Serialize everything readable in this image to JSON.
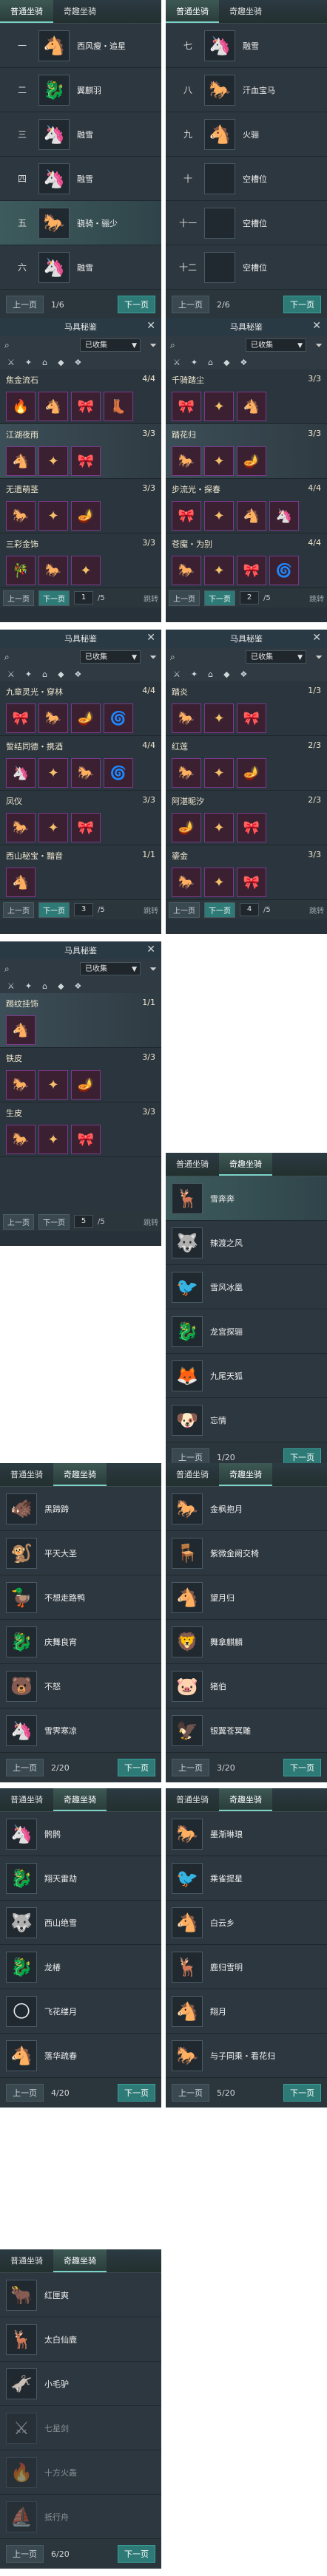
{
  "tabs": {
    "normal": "普通坐骑",
    "rare": "奇趣坐骑"
  },
  "pager": {
    "prev": "上一页",
    "next": "下一页"
  },
  "panel1": {
    "page": "1/6",
    "rows": [
      {
        "num": "一",
        "name": "西风瘦・追星",
        "icon": "🐴"
      },
      {
        "num": "二",
        "name": "翼麒羽",
        "icon": "🐉"
      },
      {
        "num": "三",
        "name": "融雪",
        "icon": "🦄"
      },
      {
        "num": "四",
        "name": "融雪",
        "icon": "🦄"
      },
      {
        "num": "五",
        "name": "骁骑・骊少",
        "icon": "🐎"
      },
      {
        "num": "六",
        "name": "融雪",
        "icon": "🦄"
      }
    ]
  },
  "panel2": {
    "page": "2/6",
    "rows": [
      {
        "num": "七",
        "name": "融雪",
        "icon": "🦄"
      },
      {
        "num": "八",
        "name": "汗血宝马",
        "icon": "🐎"
      },
      {
        "num": "九",
        "name": "火骊",
        "icon": "🐴"
      },
      {
        "num": "十",
        "name": "空槽位",
        "icon": ""
      },
      {
        "num": "十一",
        "name": "空槽位",
        "icon": ""
      },
      {
        "num": "十二",
        "name": "空槽位",
        "icon": ""
      }
    ]
  },
  "acc": {
    "title": "马具秘鉴",
    "close": "✕",
    "collected": "已收集",
    "jump": "跳转",
    "prev": "上一页",
    "next": "下一页",
    "icon_strip": [
      "⚔",
      "✦",
      "⌂",
      "◆",
      "❖"
    ]
  },
  "acc1": {
    "page": "1",
    "total": "/5",
    "rows": [
      {
        "name": "焦金流石",
        "count": "4/4",
        "items": [
          "🔥",
          "🐴",
          "🎀",
          "👢"
        ]
      },
      {
        "name": "江湖夜雨",
        "count": "3/3",
        "items": [
          "🐴",
          "✦",
          "🎀"
        ]
      },
      {
        "name": "无遗萌茎",
        "count": "3/3",
        "items": [
          "🐎",
          "✦",
          "🪔"
        ]
      },
      {
        "name": "三彩金饰",
        "count": "3/3",
        "items": [
          "🎋",
          "🐎",
          "✦"
        ]
      }
    ]
  },
  "acc2": {
    "page": "2",
    "total": "/5",
    "rows": [
      {
        "name": "千骑踏尘",
        "count": "3/3",
        "items": [
          "🎀",
          "✦",
          "🐴"
        ]
      },
      {
        "name": "踏花归",
        "count": "3/3",
        "items": [
          "🐎",
          "✦",
          "🪔"
        ]
      },
      {
        "name": "步流光・探春",
        "count": "4/4",
        "items": [
          "🎀",
          "✦",
          "🐴",
          "🦄"
        ]
      },
      {
        "name": "苍魔・为别",
        "count": "4/4",
        "items": [
          "🐎",
          "✦",
          "🎀",
          "🌀"
        ]
      }
    ]
  },
  "acc3": {
    "page": "3",
    "total": "/5",
    "rows": [
      {
        "name": "九章灵光・穿林",
        "count": "4/4",
        "items": [
          "🎀",
          "🐎",
          "🪔",
          "🌀"
        ]
      },
      {
        "name": "誓结同德・携酒",
        "count": "4/4",
        "items": [
          "🦄",
          "✦",
          "🐎",
          "🌀"
        ]
      },
      {
        "name": "凤仪",
        "count": "3/3",
        "items": [
          "🐎",
          "✦",
          "🎀"
        ]
      },
      {
        "name": "西山秘宝・黯音",
        "count": "1/1",
        "items": [
          "🐴"
        ]
      }
    ]
  },
  "acc4": {
    "page": "4",
    "total": "/5",
    "rows": [
      {
        "name": "踏炎",
        "count": "1/3",
        "items": [
          "🐎",
          "✦",
          "🎀"
        ]
      },
      {
        "name": "红莲",
        "count": "2/3",
        "items": [
          "🐎",
          "✦",
          "🪔"
        ]
      },
      {
        "name": "阿湛昵汐",
        "count": "2/3",
        "items": [
          "🪔",
          "✦",
          "🎀"
        ]
      },
      {
        "name": "鎏金",
        "count": "3/3",
        "items": [
          "🐎",
          "✦",
          "🎀"
        ]
      }
    ]
  },
  "acc5": {
    "page": "5",
    "total": "/5",
    "rows": [
      {
        "name": "踢纹挂饰",
        "count": "1/1",
        "items": [
          "🐴"
        ]
      },
      {
        "name": "铁皮",
        "count": "3/3",
        "items": [
          "🐎",
          "✦",
          "🪔"
        ]
      },
      {
        "name": "生皮",
        "count": "3/3",
        "items": [
          "🐎",
          "✦",
          "🎀"
        ]
      }
    ]
  },
  "rare1": {
    "page": "1/20",
    "rows": [
      {
        "name": "雪奔奔",
        "icon": "🦌",
        "locked": false
      },
      {
        "name": "辣渡之风",
        "icon": "🐺",
        "locked": false
      },
      {
        "name": "雪风冰凰",
        "icon": "🐦",
        "locked": false
      },
      {
        "name": "龙宫探骊",
        "icon": "🐉",
        "locked": false
      },
      {
        "name": "九尾天狐",
        "icon": "🦊",
        "locked": false
      },
      {
        "name": "忘情",
        "icon": "🐶",
        "locked": false
      }
    ]
  },
  "rare2": {
    "page": "2/20",
    "rows": [
      {
        "name": "黑蹄蹄",
        "icon": "🐗",
        "locked": false
      },
      {
        "name": "平天大圣",
        "icon": "🐒",
        "locked": false
      },
      {
        "name": "不想走路鸭",
        "icon": "🦆",
        "locked": false
      },
      {
        "name": "庆舞良宵",
        "icon": "🐉",
        "locked": false
      },
      {
        "name": "不怒",
        "icon": "🐻",
        "locked": false
      },
      {
        "name": "雪霁寒凉",
        "icon": "🦄",
        "locked": false
      }
    ]
  },
  "rare3": {
    "page": "3/20",
    "rows": [
      {
        "name": "金枫抱月",
        "icon": "🐎",
        "locked": false
      },
      {
        "name": "紫微金阙交椅",
        "icon": "🪑",
        "locked": false
      },
      {
        "name": "望月归",
        "icon": "🐴",
        "locked": false
      },
      {
        "name": "舞拿麒麟",
        "icon": "🦁",
        "locked": false
      },
      {
        "name": "猪伯",
        "icon": "🐷",
        "locked": false
      },
      {
        "name": "银翼苍冥雕",
        "icon": "🦅",
        "locked": false
      }
    ]
  },
  "rare4": {
    "page": "4/20",
    "rows": [
      {
        "name": "鹘鹘",
        "icon": "🦄",
        "locked": false
      },
      {
        "name": "翔天雷劫",
        "icon": "🐉",
        "locked": false
      },
      {
        "name": "西山绝雪",
        "icon": "🐺",
        "locked": false
      },
      {
        "name": "龙椿",
        "icon": "🐉",
        "locked": false
      },
      {
        "name": "飞花缕月",
        "icon": "🌕",
        "locked": false
      },
      {
        "name": "落华疏春",
        "icon": "🐴",
        "locked": false
      }
    ]
  },
  "rare5": {
    "page": "5/20",
    "rows": [
      {
        "name": "墨渐琳琅",
        "icon": "🐎",
        "locked": false
      },
      {
        "name": "乘雀提星",
        "icon": "🐦",
        "locked": false
      },
      {
        "name": "白云乡",
        "icon": "🐴",
        "locked": false
      },
      {
        "name": "鹿归雪明",
        "icon": "🦌",
        "locked": false
      },
      {
        "name": "翔月",
        "icon": "🐴",
        "locked": false
      },
      {
        "name": "与子同乘・看花归",
        "icon": "🐎",
        "locked": false
      }
    ]
  },
  "rare6": {
    "page": "6/20",
    "rows": [
      {
        "name": "红匣爽",
        "icon": "🐂",
        "locked": false
      },
      {
        "name": "太白仙鹿",
        "icon": "🦌",
        "locked": false
      },
      {
        "name": "小毛驴",
        "icon": "🫏",
        "locked": false
      },
      {
        "name": "七星剑",
        "icon": "⚔",
        "locked": true
      },
      {
        "name": "十方火轰",
        "icon": "🔥",
        "locked": true
      },
      {
        "name": "抵行舟",
        "icon": "⛵",
        "locked": true
      }
    ]
  }
}
